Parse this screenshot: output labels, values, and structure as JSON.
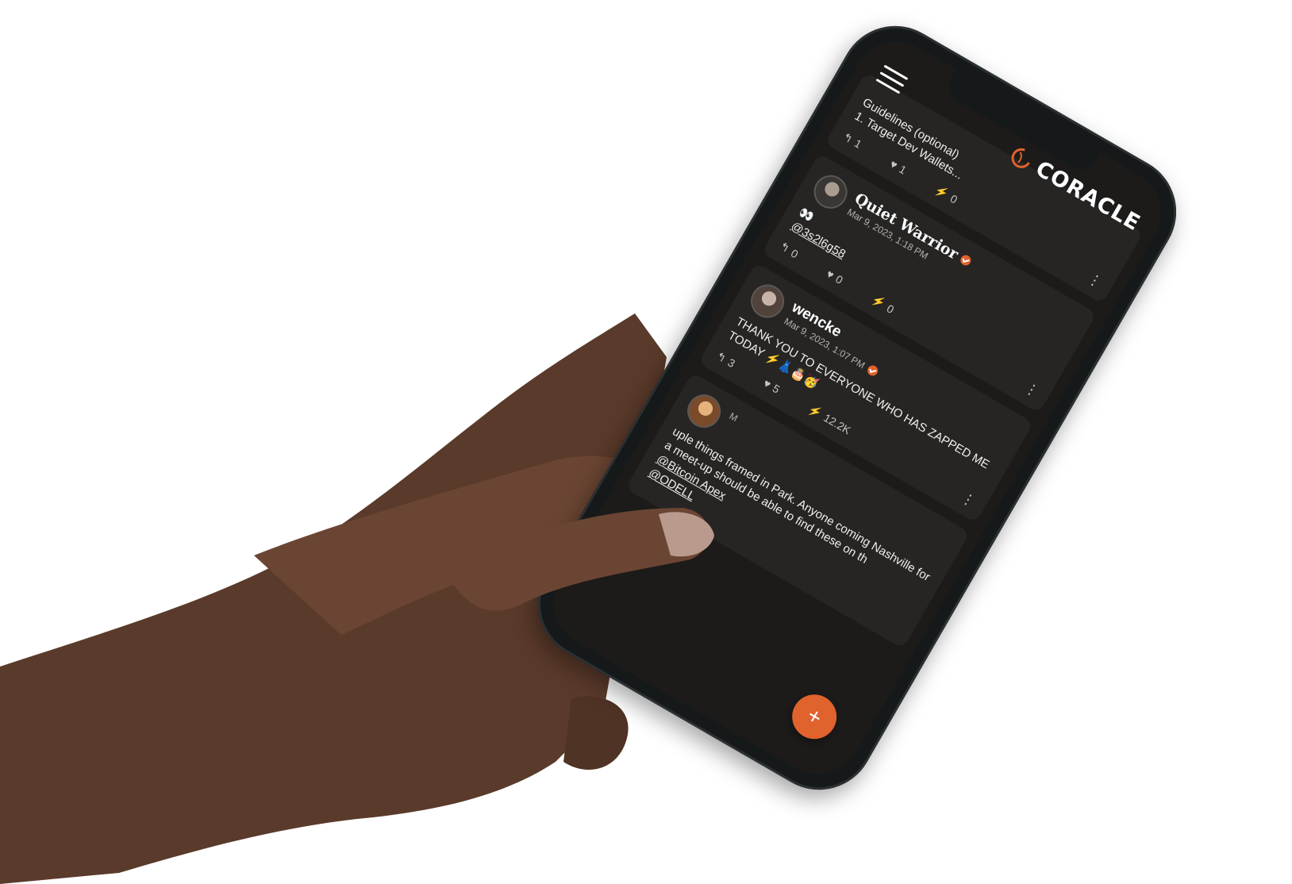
{
  "app": {
    "brand": "CORACLE",
    "fab_label": "+",
    "accent": "#e0622c"
  },
  "posts": [
    {
      "content_lines": [
        "Guidelines (optional)",
        "1. Target Dev Wallets..."
      ],
      "replies": "1",
      "likes": "1",
      "zaps": "0"
    },
    {
      "name": "Quiet Warrior",
      "date": "Mar 9, 2023, 1:18 PM",
      "content": "👀",
      "mention": "@3s2l6g58",
      "replies": "0",
      "likes": "0",
      "zaps": "0"
    },
    {
      "name": "wencke",
      "date": "Mar 9, 2023, 1:07 PM",
      "content": "THANK YOU TO EVERYONE WHO HAS ZAPPED ME TODAY ⚡️👗🎂🥳",
      "replies": "3",
      "likes": "5",
      "zaps": "12.2K"
    },
    {
      "date_fragment": "M",
      "content_fragment": "uple things framed in Park. Anyone coming Nashville for a meet-up should be able to find these on th",
      "mentions": [
        "@Bitcoin Apex",
        "@ODELL"
      ]
    }
  ],
  "icons": {
    "menu": "hamburger-icon",
    "reply": "reply-arrow-icon",
    "like": "heart-icon",
    "zap": "lightning-bolt-icon",
    "more": "vertical-dots-icon",
    "verified": "verified-badge-icon",
    "logo": "coracle-logo-icon"
  }
}
